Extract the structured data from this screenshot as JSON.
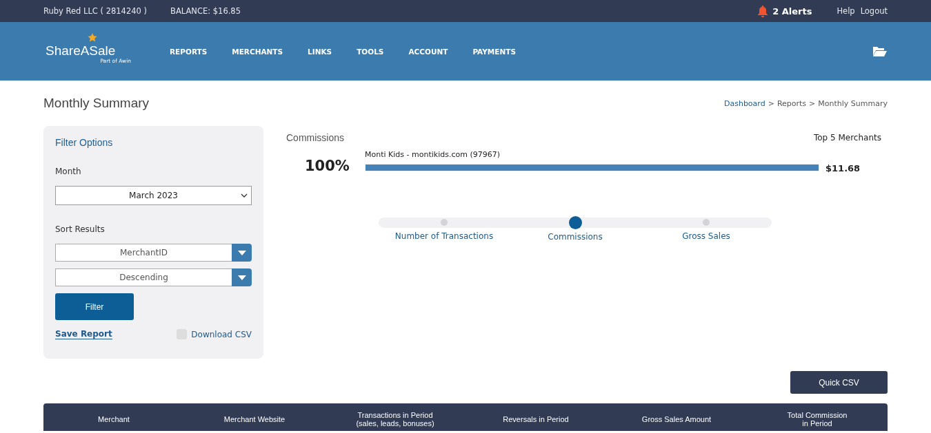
{
  "top_bar": {
    "account": "Ruby Red LLC ( 2814240 )",
    "balance": "BALANCE: $16.85",
    "alerts": "2 Alerts",
    "links": [
      "Help",
      "Logout"
    ]
  },
  "header": {
    "logo": "ShareASale",
    "logo_sub": "Part of Awin",
    "nav": [
      "REPORTS",
      "MERCHANTS",
      "LINKS",
      "TOOLS",
      "ACCOUNT",
      "PAYMENTS"
    ]
  },
  "page": {
    "title": "Monthly Summary",
    "breadcrumb": [
      {
        "label": "Dashboard",
        "kind": "link"
      },
      {
        "label": ">",
        "kind": "sep"
      },
      {
        "label": "Reports",
        "kind": "text"
      },
      {
        "label": ">",
        "kind": "sep"
      },
      {
        "label": "Monthly Summary",
        "kind": "text"
      }
    ]
  },
  "filter": {
    "title": "Filter Options",
    "month_label": "Month",
    "month": "March 2023",
    "sort_label": "Sort Results",
    "sort_by": "MerchantID",
    "order": "Descending",
    "button": "Filter",
    "save": "Save Report",
    "download": {
      "label": "Download CSV",
      "checked": false
    }
  },
  "commissions": {
    "title": "Commissions",
    "top_label": "Top 5 Merchants",
    "merchants": [
      {
        "percent": "100%",
        "name": "Monti Kids - montikids.com (97967)",
        "level": 1.0,
        "amount": "$11.68"
      }
    ],
    "metrics": [
      {
        "label": "Number of Transactions",
        "selected": false
      },
      {
        "label": "Commissions",
        "selected": true
      },
      {
        "label": "Gross Sales",
        "selected": false
      }
    ]
  },
  "quick_csv": "Quick CSV",
  "table": {
    "columns": [
      {
        "lines": [
          "Merchant"
        ]
      },
      {
        "lines": [
          "Merchant Website"
        ]
      },
      {
        "lines": [
          "Transactions in Period",
          "(sales, leads, bonuses)"
        ]
      },
      {
        "lines": [
          "Reversals in Period"
        ]
      },
      {
        "lines": [
          "Gross Sales Amount"
        ]
      },
      {
        "lines": [
          "Total Commission",
          "in Period"
        ]
      }
    ]
  }
}
